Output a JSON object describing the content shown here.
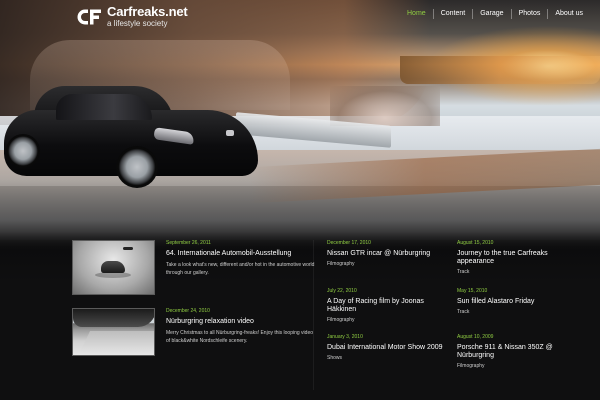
{
  "brand": {
    "name": "Carfreaks.net",
    "tagline": "a lifestyle society",
    "accent": "#8fcc42"
  },
  "nav": {
    "items": [
      {
        "label": "Home",
        "active": true
      },
      {
        "label": "Content",
        "active": false
      },
      {
        "label": "Garage",
        "active": false
      },
      {
        "label": "Photos",
        "active": false
      },
      {
        "label": "About us",
        "active": false
      }
    ]
  },
  "featured": [
    {
      "date": "September 26, 2011",
      "title": "64. Internationale Automobil-Ausstellung",
      "description": "Take a look what's new, different and/or hot in the automotive world through our gallery.",
      "thumbnail": "studio-car-thumbnail"
    },
    {
      "date": "December 24, 2010",
      "title": "Nürburgring relaxation video",
      "description": "Merry Christmas to all Nürburgring-freaks! Enjoy this looping video of black&white Nordschleife scenery.",
      "thumbnail": "snowy-track-thumbnail"
    }
  ],
  "posts_col1": [
    {
      "date": "December 17, 2010",
      "title": "Nissan GTR incar @ Nürburgring",
      "category": "Filmography"
    },
    {
      "date": "July 22, 2010",
      "title": "A Day of Racing film by Joonas Häkkinen",
      "category": "Filmography"
    },
    {
      "date": "January 3, 2010",
      "title": "Dubai International Motor Show 2009",
      "category": "Shows"
    }
  ],
  "posts_col2": [
    {
      "date": "August 15, 2010",
      "title": "Journey to the true Carfreaks appearance",
      "category": "Track"
    },
    {
      "date": "May 15, 2010",
      "title": "Sun filled Alastaro Friday",
      "category": "Track"
    },
    {
      "date": "August 10, 2009",
      "title": "Porsche 911 & Nissan 350Z @ Nürburgring",
      "category": "Filmography"
    }
  ]
}
